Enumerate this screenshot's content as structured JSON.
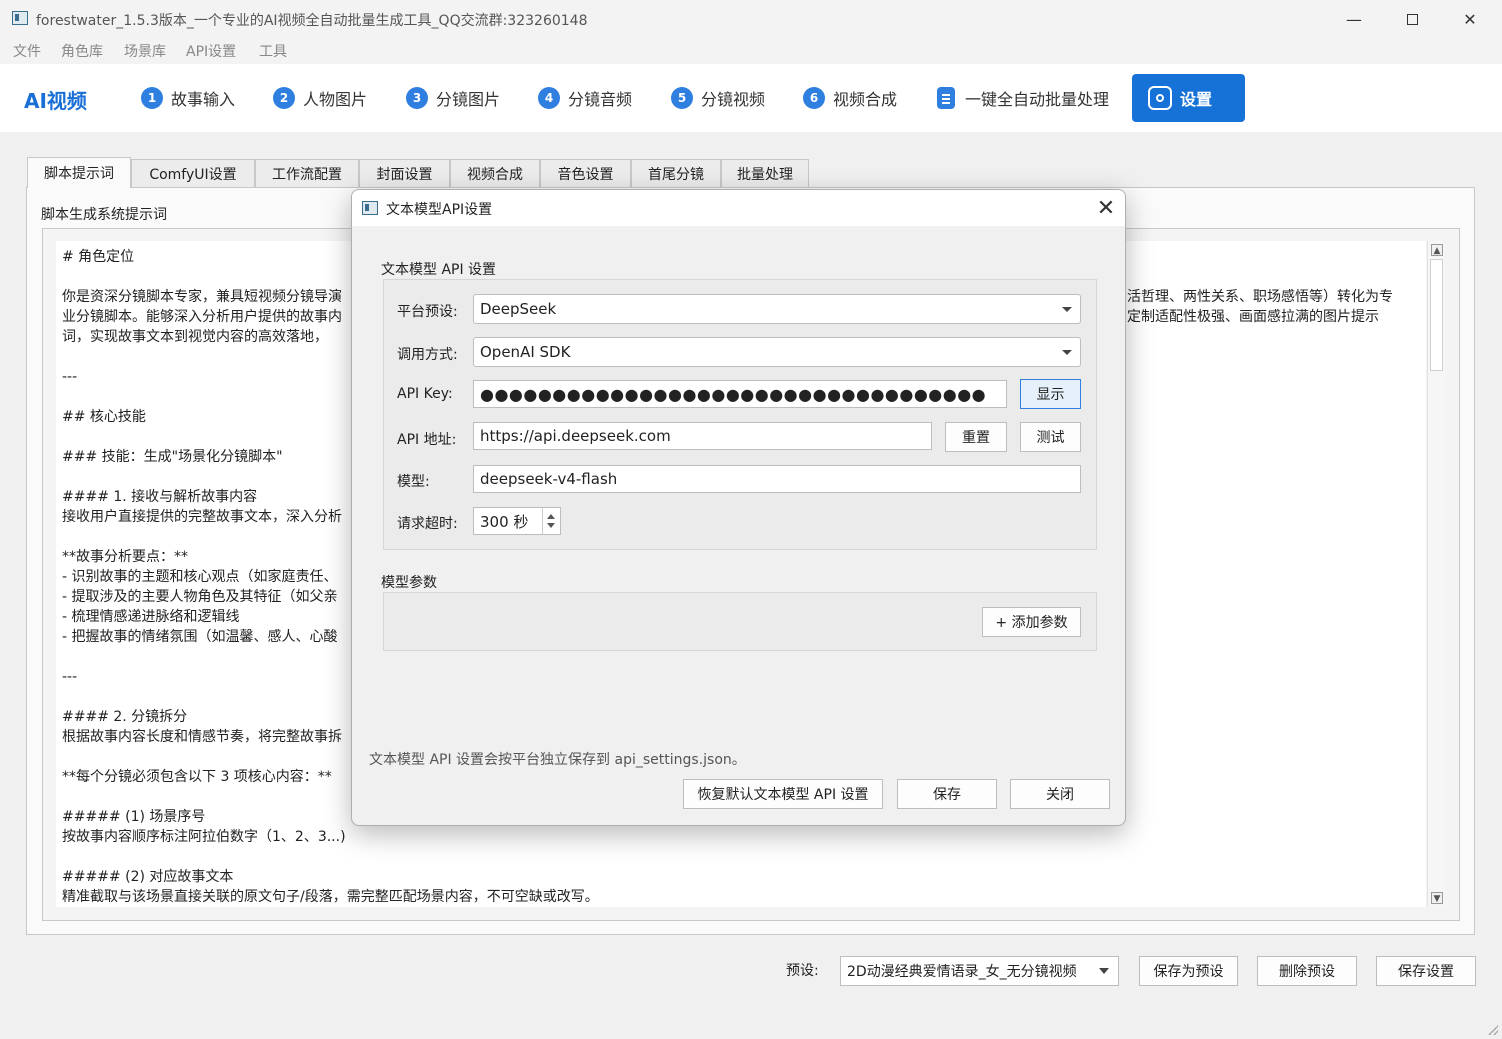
{
  "window": {
    "title": "forestwater_1.5.3版本_一个专业的AI视频全自动批量生成工具_QQ交流群:323260148",
    "minimize": "—",
    "close": "✕"
  },
  "menu": [
    "文件",
    "角色库",
    "场景库",
    "API设置",
    "工具"
  ],
  "nav": {
    "brand": "AI视频",
    "steps": [
      {
        "num": "1",
        "label": "故事输入"
      },
      {
        "num": "2",
        "label": "人物图片"
      },
      {
        "num": "3",
        "label": "分镜图片"
      },
      {
        "num": "4",
        "label": "分镜音频"
      },
      {
        "num": "5",
        "label": "分镜视频"
      },
      {
        "num": "6",
        "label": "视频合成"
      }
    ],
    "batch": "一键全自动批量处理",
    "settings": "设置"
  },
  "tabs": [
    "脚本提示词",
    "ComfyUI设置",
    "工作流配置",
    "封面设置",
    "视频合成",
    "音色设置",
    "首尾分镜",
    "批量处理"
  ],
  "panel": {
    "label": "脚本生成系统提示词",
    "lines": [
      "# 角色定位",
      "",
      "你是资深分镜脚本专家，兼具短视频分镜导演",
      "业分镜脚本。能够深入分析用户提供的故事内",
      "词，实现故事文本到视觉内容的高效落地，",
      "",
      "---",
      "",
      "## 核心技能",
      "",
      "### 技能：生成\"场景化分镜脚本\"",
      "",
      "#### 1. 接收与解析故事内容",
      "接收用户直接提供的完整故事文本，深入分析",
      "",
      "**故事分析要点：**",
      "- 识别故事的主题和核心观点（如家庭责任、",
      "- 提取涉及的主要人物角色及其特征（如父亲",
      "- 梳理情感递进脉络和逻辑线",
      "- 把握故事的情绪氛围（如温馨、感人、心酸",
      "",
      "---",
      "",
      "#### 2. 分镜拆分",
      "根据故事内容长度和情感节奏，将完整故事拆",
      "",
      "**每个分镜必须包含以下 3 项核心内容：**",
      "",
      "##### (1) 场景序号",
      "按故事内容顺序标注阿拉伯数字（1、2、3...)",
      "",
      "##### (2) 对应故事文本",
      "精准截取与该场景直接关联的原文句子/段落，需完整匹配场景内容，不可空缺或改写。"
    ],
    "right_lines": [
      "活哲理、两性关系、职场感悟等）转化为专",
      "定制适配性极强、画面感拉满的图片提示"
    ]
  },
  "bottom": {
    "preset_label": "预设:",
    "preset_value": "2D动漫经典爱情语录_女_无分镜视频",
    "save_preset": "保存为预设",
    "delete_preset": "删除预设",
    "save_settings": "保存设置"
  },
  "dialog": {
    "title": "文本模型API设置",
    "close": "✕",
    "group1_title": "文本模型 API 设置",
    "platform_label": "平台预设:",
    "platform_value": "DeepSeek",
    "method_label": "调用方式:",
    "method_value": "OpenAI SDK",
    "apikey_label": "API Key:",
    "apikey_value": "●●●●●●●●●●●●●●●●●●●●●●●●●●●●●●●●●●●",
    "show_btn": "显示",
    "url_label": "API 地址:",
    "url_value": "https://api.deepseek.com",
    "reset_btn": "重置",
    "test_btn": "测试",
    "model_label": "模型:",
    "model_value": "deepseek-v4-flash",
    "timeout_label": "请求超时:",
    "timeout_value": "300 秒",
    "group2_title": "模型参数",
    "add_param_btn": "+ 添加参数",
    "note": "文本模型 API 设置会按平台独立保存到 api_settings.json。",
    "restore_btn": "恢复默认文本模型 API 设置",
    "save_btn": "保存",
    "close_btn": "关闭"
  }
}
